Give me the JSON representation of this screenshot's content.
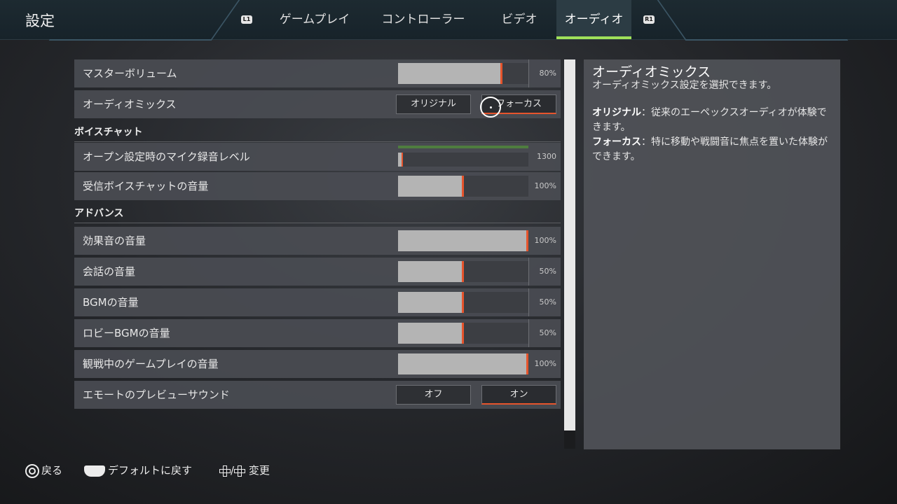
{
  "header": {
    "title": "設定",
    "bumper_left": "L1",
    "bumper_right": "R1",
    "tabs": [
      {
        "label": "ゲームプレイ",
        "active": false
      },
      {
        "label": "コントローラー",
        "active": false
      },
      {
        "label": "ビデオ",
        "active": false
      },
      {
        "label": "オーディオ",
        "active": true
      }
    ],
    "accent_color": "#9fe05a"
  },
  "settings": {
    "master_volume": {
      "label": "マスターボリューム",
      "value": 80,
      "value_text": "80%"
    },
    "audio_mix": {
      "label": "オーディオミックス",
      "options": [
        "オリジナル",
        "フォーカス"
      ],
      "selected": "フォーカス"
    },
    "voice_chat_section": "ボイスチャット",
    "mic_level": {
      "label": "オープン設定時のマイク録音レベル",
      "value": 1300,
      "value_text": "1300"
    },
    "voice_chat_volume": {
      "label": "受信ボイスチャットの音量",
      "value": 100,
      "value_text": "100%"
    },
    "advanced_section": "アドバンス",
    "sfx_volume": {
      "label": "効果音の音量",
      "value": 100,
      "value_text": "100%"
    },
    "dialogue_volume": {
      "label": "会話の音量",
      "value": 50,
      "value_text": "50%"
    },
    "bgm_volume": {
      "label": "BGMの音量",
      "value": 50,
      "value_text": "50%"
    },
    "lobby_bgm_volume": {
      "label": "ロビーBGMの音量",
      "value": 50,
      "value_text": "50%"
    },
    "spectate_volume": {
      "label": "観戦中のゲームプレイの音量",
      "value": 100,
      "value_text": "100%"
    },
    "emote_preview": {
      "label": "エモートのプレビューサウンド",
      "options": [
        "オフ",
        "オン"
      ],
      "selected": "オン"
    }
  },
  "info_panel": {
    "title": "オーディオミックス",
    "description": "オーディオミックス設定を選択できます。",
    "entries": [
      {
        "term": "オリジナル",
        "text": "：従来のエーペックスオーディオが体験できます。"
      },
      {
        "term": "フォーカス",
        "text": "：特に移動や戦闘音に焦点を置いた体験ができます。"
      }
    ]
  },
  "footer": {
    "back": "戻る",
    "reset": "デフォルトに戻す",
    "change": "変更",
    "change_sep": "/"
  },
  "colors": {
    "slider_handle": "#e6542c",
    "mic_meter": "#4f7d3f"
  }
}
